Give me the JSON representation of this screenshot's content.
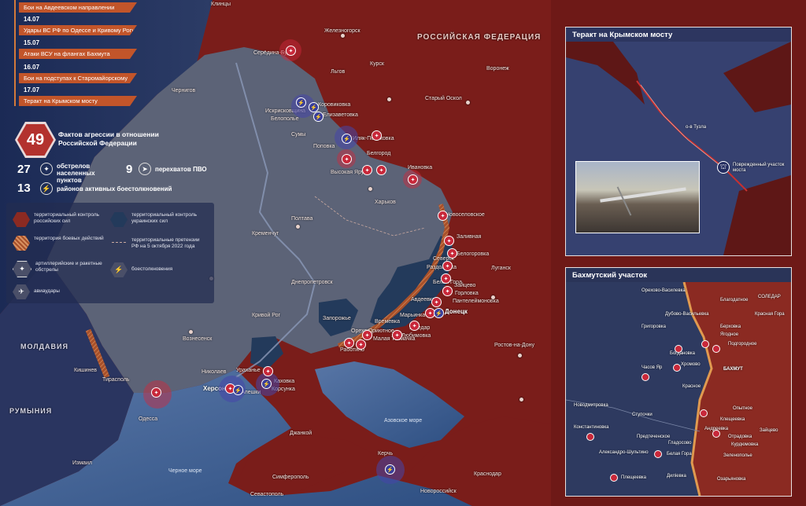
{
  "timeline": [
    {
      "date": "",
      "label": "Бои на Авдеевском направлении"
    },
    {
      "date": "14.07",
      "label": "Удары ВС РФ по Одессе и Кривому Рогу"
    },
    {
      "date": "15.07",
      "label": "Атаки ВСУ на флангах Бахмута"
    },
    {
      "date": "16.07",
      "label": "Бои на подступах к Старомайорскому"
    },
    {
      "date": "17.07",
      "label": "Теракт на Крымском мосту"
    }
  ],
  "stats": {
    "total": "49",
    "total_label": "Фактов агрессии в отношении Российской Федерации",
    "shelling_num": "27",
    "shelling_label": "обстрелов населенных пунктов",
    "intercept_num": "9",
    "intercept_label": "перехватов ПВО",
    "clashes_num": "13",
    "clashes_label": "районов активных боестолкновений"
  },
  "legend": {
    "ru_control": "территориальный контроль российских сил",
    "ua_control": "территориальный контроль украинских сил",
    "combat": "территория боевых действий",
    "claims": "территориальные претензии РФ на 5 октября 2022 года",
    "artillery": "артиллерийские и ракетные обстрелы",
    "clashes": "боестолкновения",
    "airstrikes": "авиаудары"
  },
  "map_labels": {
    "russia": "РОССИЙСКАЯ ФЕДЕРАЦИЯ",
    "moldova": "МОЛДАВИЯ",
    "romania": "РУМЫНИЯ",
    "black_sea": "Черное море",
    "azov_sea": "Азовское море",
    "cities": [
      "Клинцы",
      "Железногорск",
      "Курск",
      "Льгов",
      "Старый Оскол",
      "Воронеж",
      "Чернигов",
      "Серёдина-Буда",
      "Коровиковка",
      "Искрисковщина",
      "Елизаветовка",
      "Белополье",
      "Сумы",
      "Иляк-Пеньковка",
      "Поповка",
      "Белгород",
      "Высокая Яруга",
      "Ивановка",
      "Харьков",
      "Полтава",
      "Кременчуг",
      "Днепропетровск",
      "Запорожье",
      "Кривой Рог",
      "Вознесенск",
      "Николаев",
      "Херсон",
      "Одесса",
      "Кишинев",
      "Тирасполь",
      "Измаил",
      "Новоселовское",
      "Заливная",
      "Северск",
      "Белогоровка",
      "Раздоловка",
      "Белая Гора",
      "Зайцево",
      "Горловка",
      "Пантелеймоновка",
      "Авдеевка",
      "Марьинка",
      "Донецк",
      "Угледар",
      "Любимовка",
      "Времевка",
      "Приютное",
      "Орехов",
      "Малая Токмачка",
      "Работино",
      "Ураханье",
      "Каховка",
      "Корсунка",
      "Алешки",
      "Джанкой",
      "Симферополь",
      "Севастополь",
      "Керчь",
      "Новороссийск",
      "Краснодар",
      "Ростов-на-Дону",
      "Луганск"
    ]
  },
  "inset_bridge": {
    "title": "Теракт на Крымском мосту",
    "island": "о-в Тузла",
    "damaged": "Поврежденный участок моста"
  },
  "inset_bakhmut": {
    "title": "Бахмутский участок",
    "places": [
      "Орехово-Василевка",
      "Благодатное",
      "СОЛЕДАР",
      "Красная Гора",
      "Дубово-Васильевка",
      "Григоровка",
      "Берховка",
      "Ягодное",
      "Подгородное",
      "Богдановка",
      "Хромово",
      "Часов Яр",
      "Красное",
      "БАХМУТ",
      "Опытное",
      "Клещеевка",
      "Новодмитровка",
      "Ступочки",
      "Константиновка",
      "Предтеченское",
      "Андреевка",
      "Отрадовка",
      "Зайцево",
      "Курдюмовка",
      "Зеленополье",
      "Александро-Шультино",
      "Белая Гора",
      "Озарьяновка",
      "Плещеевка",
      "Диліевка",
      "Гладосово"
    ]
  },
  "colors": {
    "russia": "#7a1d1a",
    "ukraine": "#5c6377",
    "sea": "#3d5d8c",
    "ua_control": "#233a5b"
  }
}
